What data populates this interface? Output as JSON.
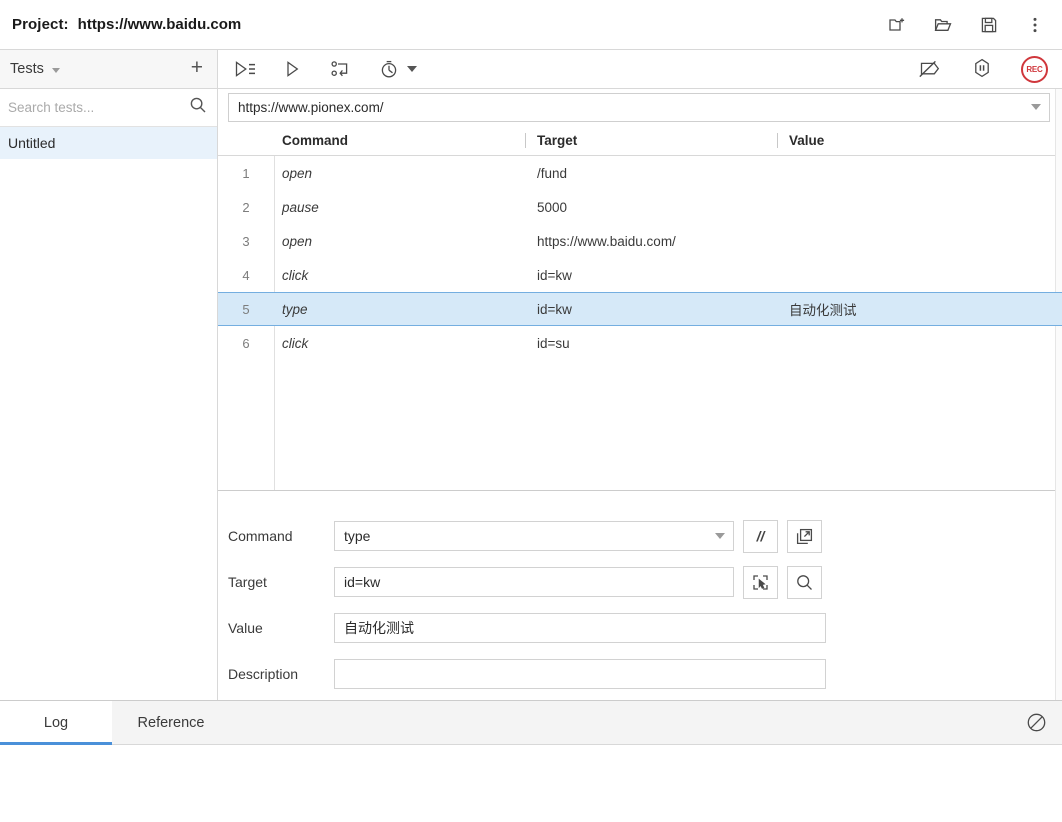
{
  "titlebar": {
    "project_label": "Project:",
    "project_url": "https://www.baidu.com",
    "actions": [
      {
        "name": "new-project-icon",
        "label": "New project"
      },
      {
        "name": "open-project-icon",
        "label": "Open project"
      },
      {
        "name": "save-project-icon",
        "label": "Save project"
      },
      {
        "name": "more-options-icon",
        "label": "More options"
      }
    ]
  },
  "sidebar": {
    "header_title": "Tests",
    "add_button_label": "+",
    "search": {
      "placeholder": "Search tests...",
      "value": ""
    },
    "tests": [
      {
        "label": "Untitled",
        "selected": true
      }
    ]
  },
  "toolbar": {
    "left": [
      {
        "name": "run-all-tests-icon",
        "label": "Run all tests"
      },
      {
        "name": "run-current-test-icon",
        "label": "Run current test"
      },
      {
        "name": "step-over-icon",
        "label": "Step over current command"
      },
      {
        "name": "test-execution-speed-icon",
        "label": "Test execution speed"
      }
    ],
    "right": [
      {
        "name": "disable-breakpoints-icon",
        "label": "Disable breakpoints"
      },
      {
        "name": "pause-icon",
        "label": "Pause test execution"
      },
      {
        "name": "record-button",
        "label": "REC"
      }
    ]
  },
  "editor": {
    "base_url": "https://www.pionex.com/",
    "columns": [
      "Command",
      "Target",
      "Value"
    ],
    "rows": [
      {
        "num": "1",
        "command": "open",
        "target": "/fund",
        "value": "",
        "selected": false
      },
      {
        "num": "2",
        "command": "pause",
        "target": "5000",
        "value": "",
        "selected": false
      },
      {
        "num": "3",
        "command": "open",
        "target": "https://www.baidu.com/",
        "value": "",
        "selected": false
      },
      {
        "num": "4",
        "command": "click",
        "target": "id=kw",
        "value": "",
        "selected": false
      },
      {
        "num": "5",
        "command": "type",
        "target": "id=kw",
        "value": "自动化测试",
        "selected": true
      },
      {
        "num": "6",
        "command": "click",
        "target": "id=su",
        "value": "",
        "selected": false
      }
    ]
  },
  "detail": {
    "command_label": "Command",
    "command_value": "type",
    "target_label": "Target",
    "target_value": "id=kw",
    "value_label": "Value",
    "value_value": "自动化测试",
    "description_label": "Description",
    "description_value": "",
    "buttons": [
      {
        "name": "toggle-comment-button",
        "label": "//"
      },
      {
        "name": "open-command-reference-button",
        "label": ""
      },
      {
        "name": "select-target-button",
        "label": ""
      },
      {
        "name": "find-target-button",
        "label": ""
      }
    ]
  },
  "bottom": {
    "tabs": [
      {
        "label": "Log",
        "active": true
      },
      {
        "label": "Reference",
        "active": false
      }
    ],
    "clear_button_label": "Clear log",
    "log_lines": []
  },
  "colors": {
    "accent_blue": "#4a90d9",
    "selected_row": "#d6e9f8",
    "selected_row_border": "#74aee0",
    "record_red": "#d0373c",
    "sidebar_selected": "#e8f2fb",
    "panel_bg": "#f4f4f4",
    "border": "#d8d8d8"
  }
}
